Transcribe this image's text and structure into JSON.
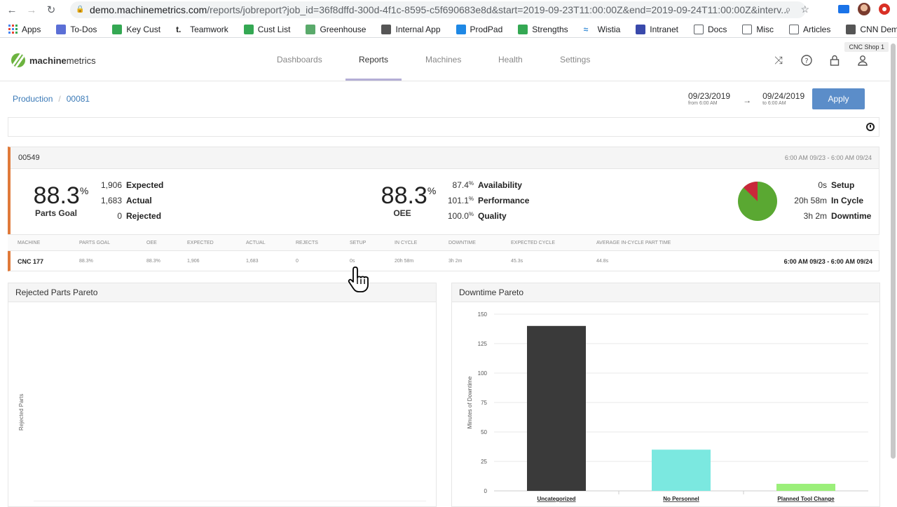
{
  "browser": {
    "url_host": "demo.machinemetrics.com",
    "url_path": "/reports/jobreport?job_id=36f8dffd-300d-4f1c-8595-c5f690683e8d&start=2019-09-23T11:00:00Z&end=2019-09-24T11:00:00Z&interv...",
    "bookmarks": [
      "Apps",
      "To-Dos",
      "Key Cust",
      "Teamwork",
      "Cust List",
      "Greenhouse",
      "Internal App",
      "ProdPad",
      "Strengths",
      "Wistia",
      "Intranet",
      "Docs",
      "Misc",
      "Articles",
      "CNN Democratic..."
    ]
  },
  "app": {
    "logo_bold": "machine",
    "logo_light": "metrics",
    "shop": "CNC Shop 1",
    "nav": [
      "Dashboards",
      "Reports",
      "Machines",
      "Health",
      "Settings"
    ],
    "active_nav": "Reports"
  },
  "breadcrumb": [
    "Production",
    "00081"
  ],
  "date_range": {
    "start": "09/23/2019",
    "start_sub": "from 6:00 AM",
    "end": "09/24/2019",
    "end_sub": "to 6:00 AM",
    "apply_label": "Apply"
  },
  "job": {
    "id": "00549",
    "range": "6:00 AM 09/23 - 6:00 AM 09/24",
    "parts_goal": {
      "value": "88.3",
      "unit": "%",
      "label": "Parts Goal"
    },
    "counts": [
      {
        "value": "1,906",
        "label": "Expected"
      },
      {
        "value": "1,683",
        "label": "Actual"
      },
      {
        "value": "0",
        "label": "Rejected"
      }
    ],
    "oee": {
      "value": "88.3",
      "unit": "%",
      "label": "OEE"
    },
    "factors": [
      {
        "value": "87.4",
        "unit": "%",
        "label": "Availability"
      },
      {
        "value": "101.1",
        "unit": "%",
        "label": "Performance"
      },
      {
        "value": "100.0",
        "unit": "%",
        "label": "Quality"
      }
    ],
    "times": [
      {
        "value": "0s",
        "label": "Setup"
      },
      {
        "value": "20h 58m",
        "label": "In Cycle"
      },
      {
        "value": "3h 2m",
        "label": "Downtime"
      }
    ],
    "pie_colors": {
      "in_cycle": "#5aa832",
      "downtime": "#c8283a"
    },
    "pie_fraction_downtime": 0.127
  },
  "table": {
    "headers": [
      "MACHINE",
      "PARTS GOAL",
      "OEE",
      "EXPECTED",
      "ACTUAL",
      "REJECTS",
      "SETUP",
      "IN CYCLE",
      "DOWNTIME",
      "EXPECTED CYCLE",
      "AVERAGE IN-CYCLE PART TIME"
    ],
    "row": [
      "CNC 177",
      "88.3%",
      "88.3%",
      "1,906",
      "1,683",
      "0",
      "0s",
      "20h 58m",
      "3h 2m",
      "45.3s",
      "44.8s"
    ],
    "row_range": "6:00 AM 09/23 - 6:00 AM 09/24"
  },
  "rejected_panel": {
    "title": "Rejected Parts Pareto",
    "ylabel": "Rejected Parts"
  },
  "downtime_panel": {
    "title": "Downtime Pareto"
  },
  "chart_data": {
    "type": "bar",
    "title": "Downtime Pareto",
    "categories": [
      "Uncategorized",
      "No Personnel",
      "Planned Tool Change"
    ],
    "values": [
      140,
      35,
      6
    ],
    "colors": [
      "#3a3a3a",
      "#7be8e0",
      "#9bef7a"
    ],
    "ylabel": "Minutes of Downtime",
    "xlabel": "",
    "ylim": [
      0,
      150
    ],
    "yticks": [
      0,
      25,
      50,
      75,
      100,
      125,
      150
    ],
    "grid": true
  }
}
